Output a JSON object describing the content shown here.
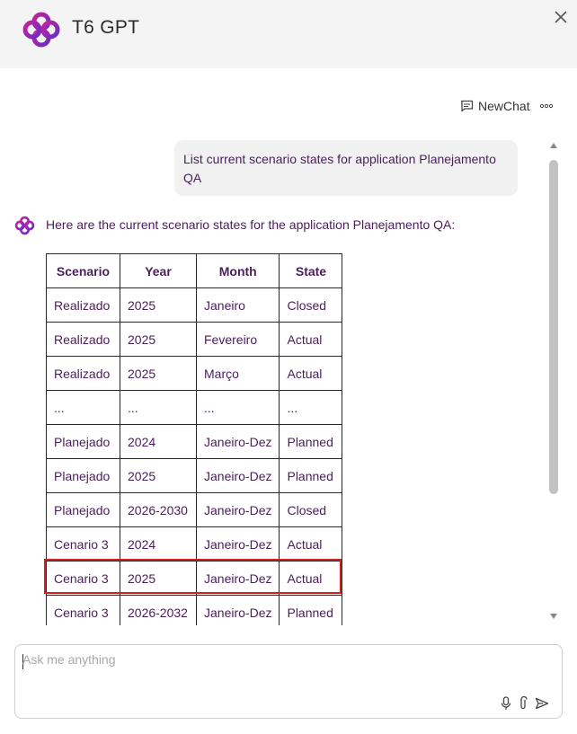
{
  "header": {
    "title": "T6 GPT"
  },
  "toolbar": {
    "new_chat_label": "NewChat"
  },
  "conversation": {
    "user_message": "List current scenario states for application Planejamento QA",
    "bot_intro": "Here are the current scenario states for the application Planejamento QA:",
    "table": {
      "headers": [
        "Scenario",
        "Year",
        "Month",
        "State"
      ],
      "rows": [
        [
          "Realizado",
          "2025",
          "Janeiro",
          "Closed"
        ],
        [
          "Realizado",
          "2025",
          "Fevereiro",
          "Actual"
        ],
        [
          "Realizado",
          "2025",
          "Março",
          "Actual"
        ],
        [
          "...",
          "...",
          "...",
          "..."
        ],
        [
          "Planejado",
          "2024",
          "Janeiro-Dez",
          "Planned"
        ],
        [
          "Planejado",
          "2025",
          "Janeiro-Dez",
          "Planned"
        ],
        [
          "Planejado",
          "2026-2030",
          "Janeiro-Dez",
          "Closed"
        ],
        [
          "Cenario 3",
          "2024",
          "Janeiro-Dez",
          "Actual"
        ],
        [
          "Cenario 3",
          "2025",
          "Janeiro-Dez",
          "Actual"
        ],
        [
          "Cenario 3",
          "2026-2032",
          "Janeiro-Dez",
          "Planned"
        ]
      ]
    }
  },
  "input": {
    "placeholder": "Ask me anything"
  },
  "icons": {
    "logo": "t6-logo-icon",
    "close": "close-icon",
    "new_chat": "chat-icon",
    "more": "more-icon",
    "mic": "microphone-icon",
    "attach": "paperclip-icon",
    "send": "send-icon"
  },
  "colors": {
    "accent": "#9b2bbf",
    "text": "#4a1e5a",
    "highlight": "#d32020"
  }
}
